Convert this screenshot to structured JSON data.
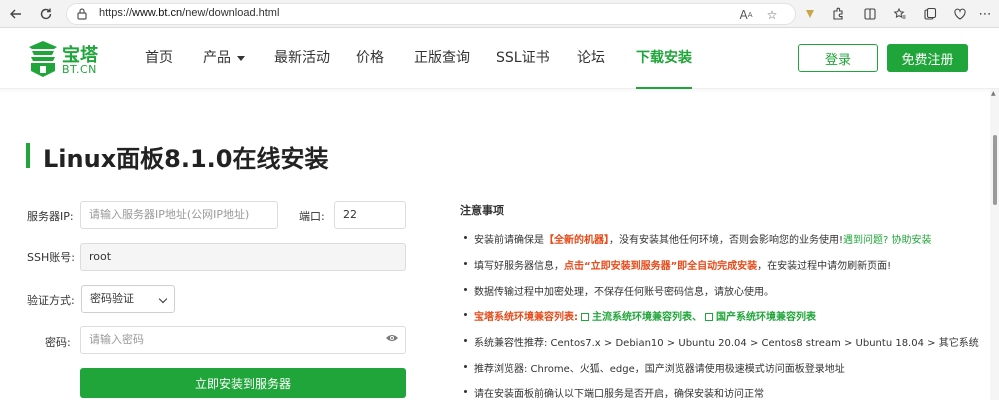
{
  "browser": {
    "url_prefix": "https://",
    "url_host": "www.bt.cn",
    "url_path": "/new/download.html"
  },
  "header": {
    "logo_cn": "宝塔",
    "logo_en": "BT.CN",
    "nav": [
      "首页",
      "产品",
      "最新活动",
      "价格",
      "正版查询",
      "SSL证书",
      "论坛",
      "下载安装"
    ],
    "active_nav": "下载安装",
    "login": "登录",
    "register": "免费注册"
  },
  "page": {
    "title": "Linux面板8.1.0在线安装"
  },
  "form": {
    "server_ip_label": "服务器IP:",
    "server_ip_placeholder": "请输入服务器IP地址(公网IP地址)",
    "port_label": "端口:",
    "port_value": "22",
    "ssh_label": "SSH账号:",
    "ssh_value": "root",
    "auth_label": "验证方式:",
    "auth_value": "密码验证",
    "password_label": "密码:",
    "password_placeholder": "请输入密码",
    "submit": "立即安装到服务器"
  },
  "notes": {
    "title": "注意事项",
    "n1_a": "安装前请确保是",
    "n1_b": "【全新的机器】",
    "n1_c": "，没有安装其他任何环境，否则会影响您的业务使用!",
    "n1_d": "遇到问题? 协助安装",
    "n2_a": "填写好服务器信息，",
    "n2_b": "点击“立即安装到服务器”即全自动完成安装",
    "n2_c": "，在安装过程中请勿刷新页面!",
    "n3": "数据传输过程中加密处理，不保存任何账号密码信息，请放心使用。",
    "n4_a": "宝塔系统环境兼容列表:",
    "n4_b": "主流系统环境兼容列表、",
    "n4_c": "国产系统环境兼容列表",
    "n5": "系统兼容性推荐: Centos7.x > Debian10 > Ubuntu 20.04 > Centos8 stream > Ubuntu 18.04 > 其它系统",
    "n6": "推荐浏览器: Chrome、火狐、edge，国产浏览器请使用极速模式访问面板登录地址",
    "n7": "请在安装面板前确认以下端口服务是否开启，确保安装和访问正常"
  },
  "colors": {
    "brand_green": "#20a53a",
    "highlight_red": "#e64a19"
  }
}
